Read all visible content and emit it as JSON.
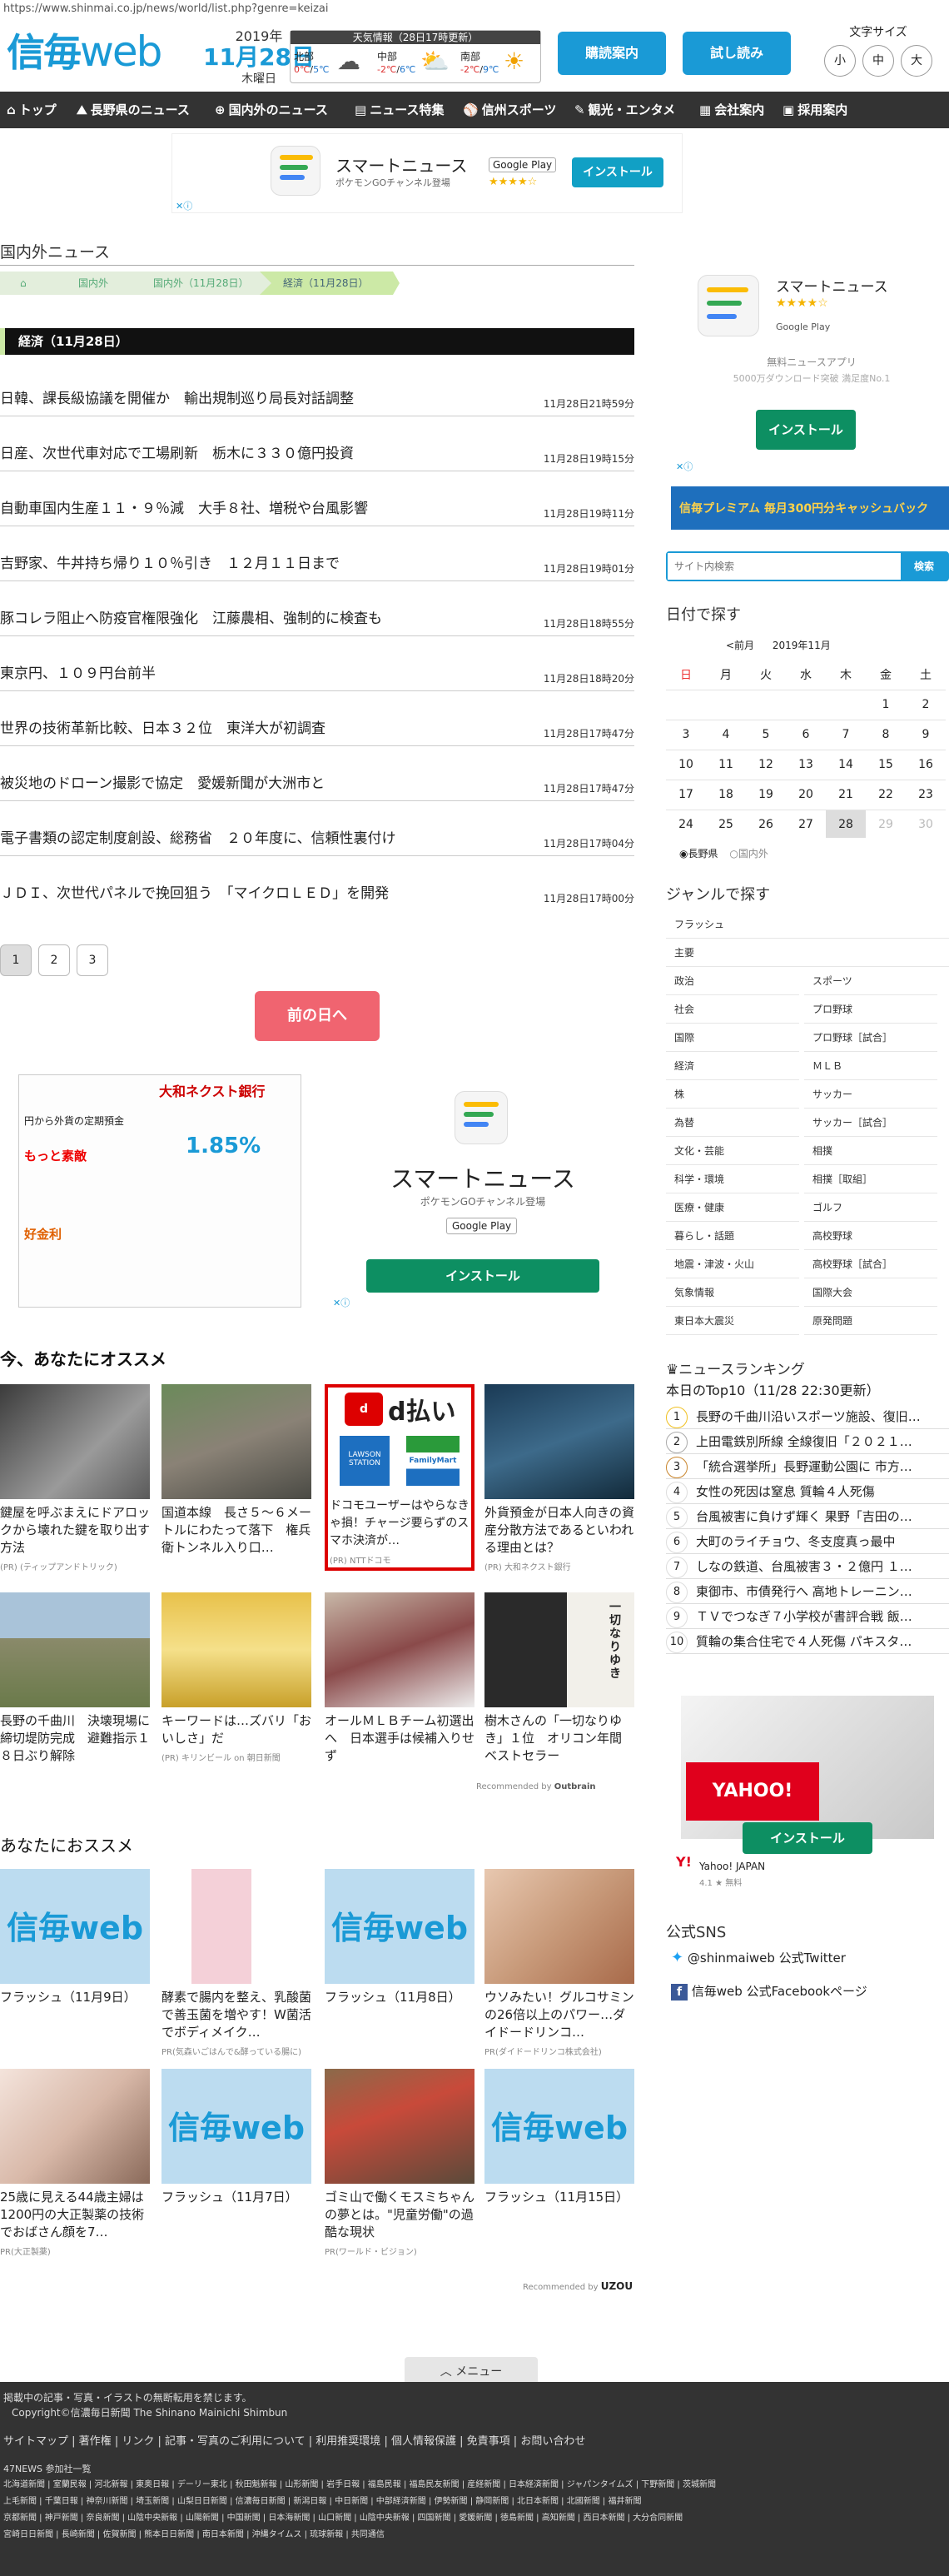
{
  "url": "https://www.shinmai.co.jp/news/world/list.php?genre=keizai",
  "header": {
    "logo_kanji": "信毎",
    "logo_web": "web",
    "date_year": "2019年",
    "date_md": "11月28日",
    "date_wday": "木曜日",
    "weather_title": "天気情報（28日17時更新）",
    "weather": [
      {
        "name": "北部",
        "hi": "0℃",
        "lo": "5℃",
        "icon": "cloud-icon",
        "glyph": "☁"
      },
      {
        "name": "中部",
        "hi": "-2℃",
        "lo": "6℃",
        "icon": "cloud-sun-icon",
        "glyph": "⛅"
      },
      {
        "name": "南部",
        "hi": "-2℃",
        "lo": "9℃",
        "icon": "sun-icon",
        "glyph": "☀"
      }
    ],
    "subscribe": "購読案内",
    "trial": "試し読み",
    "fontsize_label": "文字サイズ",
    "fontsizes": [
      "小",
      "中",
      "大"
    ]
  },
  "nav": [
    {
      "label": "トップ",
      "glyph": "⌂"
    },
    {
      "label": "長野県のニュース",
      "glyph": "⛰"
    },
    {
      "label": "国内外のニュース",
      "glyph": "⊕"
    },
    {
      "label": "ニュース特集",
      "glyph": "▤"
    },
    {
      "label": "信州スポーツ",
      "glyph": "⚾"
    },
    {
      "label": "観光・エンタメ",
      "glyph": "✎"
    },
    {
      "label": "会社案内",
      "glyph": "▦"
    },
    {
      "label": "採用案内",
      "glyph": "▣"
    }
  ],
  "ad": {
    "app_name": "スマートニュース",
    "app_sub": "ポケモンGOチャンネル登場",
    "gplay": "Google Play",
    "install": "インストール",
    "stars": "★★★★☆",
    "side_desc": "無料ニュースアプリ",
    "side_desc2": "5000万ダウンロード突破 満足度No.1"
  },
  "page_title": "国内外ニュース",
  "breadcrumbs": [
    "国内外",
    "国内外（11月28日）",
    "経済（11月28日）"
  ],
  "section_title": "経済（11月28日）",
  "news": [
    {
      "title": "日韓、課長級協議を開催か　輸出規制巡り局長対話調整",
      "date": "11月28日21時59分"
    },
    {
      "title": "日産、次世代車対応で工場刷新　栃木に３３０億円投資",
      "date": "11月28日19時15分"
    },
    {
      "title": "自動車国内生産１１・９％減　大手８社、増税や台風影響",
      "date": "11月28日19時11分"
    },
    {
      "title": "吉野家、牛丼持ち帰り１０％引き　１２月１１日まで",
      "date": "11月28日19時01分"
    },
    {
      "title": "豚コレラ阻止へ防疫官権限強化　江藤農相、強制的に検査も",
      "date": "11月28日18時55分"
    },
    {
      "title": "東京円、１０９円台前半",
      "date": "11月28日18時20分"
    },
    {
      "title": "世界の技術革新比較、日本３２位　東洋大が初調査",
      "date": "11月28日17時47分"
    },
    {
      "title": "被災地のドローン撮影で協定　愛媛新聞が大洲市と",
      "date": "11月28日17時47分"
    },
    {
      "title": "電子書類の認定制度創設、総務省　２０年度に、信頼性裏付け",
      "date": "11月28日17時04分"
    },
    {
      "title": "ＪＤＩ、次世代パネルで挽回狙う　「マイクロＬＥＤ」を開発",
      "date": "11月28日17時00分"
    }
  ],
  "pages": [
    "1",
    "2",
    "3"
  ],
  "prev_day": "前の日へ",
  "bank_ad": {
    "brand": "大和ネクスト銀行",
    "rate": "1.85",
    "l1": "円から外貨の定期預金",
    "l2": "金利",
    "l3": "もっと素敵",
    "l4": "好金利"
  },
  "osusume_title": "今、あなたにオススメ",
  "osusume": [
    {
      "title": "鍵屋を呼ぶまえにドアロックから壊れた鍵を取り出す方法",
      "src": "(PR) (ティップアンドトリック)"
    },
    {
      "title": "国道本線　長さ５～６メートルにわたって落下　権兵衛トンネル入り口…",
      "src": ""
    },
    {
      "title": "ドコモユーザーはやらなきゃ損！チャージ要らずのスマホ決済が…",
      "src": "(PR) NTTドコモ"
    },
    {
      "title": "外貨預金が日本人向きの資産分散方法であるといわれる理由とは？",
      "src": "(PR) 大和ネクスト銀行"
    },
    {
      "title": "長野の千曲川　決壊現場に締切堤防完成　避難指示１８日ぶり解除",
      "src": ""
    },
    {
      "title": "キーワードは…ズバリ「おいしさ」だ",
      "src": "(PR) キリンビール on 朝日新聞"
    },
    {
      "title": "オールＭＬＢチーム初選出へ　日本選手は候補入りせず",
      "src": ""
    },
    {
      "title": "樹木さんの「一切なりゆき」１位　オリコン年間ベストセラー",
      "src": ""
    }
  ],
  "dbarai": {
    "title": "d払い",
    "lawson": "LAWSON",
    "station": "STATION",
    "fm": "FamilyMart"
  },
  "book": "一切なりゆき",
  "recommended_by": "Recommended by",
  "outbrain": "Outbrain",
  "anata_title": "あなたにおススメ",
  "anata": [
    {
      "title": "フラッシュ（11月9日）",
      "src": "",
      "logo": true
    },
    {
      "title": "酵素で腸内を整え、乳酸菌で善玉菌を増やす！W菌活でボディメイク…",
      "src": "PR(気森いごはんで&酵っている腸に)",
      "logo": false
    },
    {
      "title": "フラッシュ（11月8日）",
      "src": "",
      "logo": true
    },
    {
      "title": "ウソみたい！グルコサミンの26倍以上のパワー…ダイドードリンコ…",
      "src": "PR(ダイドードリンコ株式会社)",
      "logo": false
    },
    {
      "title": "25歳に見える44歳主婦は1200円の大正製薬の技術でおばさん顔を7…",
      "src": "PR(大正製薬)",
      "logo": false
    },
    {
      "title": "フラッシュ（11月7日）",
      "src": "",
      "logo": true
    },
    {
      "title": "ゴミ山で働くモスミちゃんの夢とは。\"児童労働\"の過酷な現状",
      "src": "PR(ワールド・ビジョン)",
      "logo": false
    },
    {
      "title": "フラッシュ（11月15日）",
      "src": "",
      "logo": true
    }
  ],
  "shinmai_logo_small": "信毎web",
  "recommended_by2": "Recommended by",
  "uzou": "UZOU",
  "sidebar": {
    "prem_text": "信毎プレミアム 毎月300円分キャッシュバック",
    "search_placeholder": "サイト内検索",
    "search_btn": "検索",
    "by_date": "日付で探す",
    "prev_month": "<前月",
    "month": "2019年11月",
    "weekdays": [
      "日",
      "月",
      "火",
      "水",
      "木",
      "金",
      "土"
    ],
    "days": [
      [
        "",
        "",
        "",
        "",
        "",
        "1",
        "2"
      ],
      [
        "3",
        "4",
        "5",
        "6",
        "7",
        "8",
        "9"
      ],
      [
        "10",
        "11",
        "12",
        "13",
        "14",
        "15",
        "16"
      ],
      [
        "17",
        "18",
        "19",
        "20",
        "21",
        "22",
        "23"
      ],
      [
        "24",
        "25",
        "26",
        "27",
        "28",
        "29",
        "30"
      ]
    ],
    "radio1": "長野県",
    "radio2": "国内外",
    "by_genre": "ジャンルで探す",
    "genres": [
      "フラッシュ",
      "主要",
      "政治",
      "スポーツ",
      "社会",
      "プロ野球",
      "国際",
      "プロ野球［試合］",
      "経済",
      "ＭＬＢ",
      "株",
      "サッカー",
      "為替",
      "サッカー［試合］",
      "文化・芸能",
      "相撲",
      "科学・環境",
      "相撲［取組］",
      "医療・健康",
      "ゴルフ",
      "暮らし・話題",
      "高校野球",
      "地震・津波・火山",
      "高校野球［試合］",
      "気象情報",
      "国際大会",
      "東日本大震災",
      "原発問題"
    ],
    "ranking_title": "ニュースランキング",
    "ranking_sub": "本日のTop10（11/28 22:30更新）",
    "ranking": [
      "長野の千曲川沿いスポーツ施設、復旧…",
      "上田電鉄別所線 全線復旧「２０２１…",
      "「統合選挙所」長野運動公園に 市方…",
      "女性の死因は窒息 質輪４人死傷",
      "台風被害に負けず輝く 果野「吉田の…",
      "大町のライチョウ、冬支度真っ最中",
      "しなの鉄道、台風被害３・２億円 １…",
      "東御市、市債発行へ 高地トレーニン…",
      "ＴＶでつなぎ７小学校が書評合戦 飯…",
      "質輪の集合住宅で４人死傷 パキスタ…"
    ],
    "yahoo_name": "Yahoo! JAPAN",
    "yahoo_meta": "4.1 ★ 無料",
    "sns_title": "公式SNS",
    "twitter": "@shinmaiweb 公式Twitter",
    "facebook": "信毎web 公式Facebookページ"
  },
  "footer": {
    "menu": "メニュー",
    "notice": "掲載中の記事・写真・イラストの無断転用を禁じます。",
    "copyright": "Copyright©信濃毎日新聞 The Shinano Mainichi Shimbun",
    "links": [
      "サイトマップ",
      "著作権",
      "リンク",
      "記事・写真のご利用について",
      "利用推奨環境",
      "個人情報保護",
      "免責事項",
      "お問い合わせ"
    ],
    "n47_title": "47NEWS 参加社一覧",
    "n47a": "北海道新聞 | 室蘭民報 | 河北新報 | 東奥日報 | デーリー東北 | 秋田魁新報 | 山形新聞 | 岩手日報 | 福島民報 | 福島民友新聞 | 産経新聞 | 日本経済新聞 | ジャパンタイムズ | 下野新聞 | 茨城新聞",
    "n47b": "上毛新聞 | 千葉日報 | 神奈川新聞 | 埼玉新聞 | 山梨日日新聞 | 信濃毎日新聞 | 新潟日報 | 中日新聞 | 中部経済新聞 | 伊勢新聞 | 静岡新聞 | 北日本新聞 | 北國新聞 | 福井新聞",
    "n47c": "京都新聞 | 神戸新聞 | 奈良新聞 | 山陰中央新報 | 山陽新聞 | 中国新聞 | 日本海新聞 | 山口新聞 | 山陰中央新報 | 四国新聞 | 愛媛新聞 | 徳島新聞 | 高知新聞 | 西日本新聞 | 大分合同新聞",
    "n47d": "宮崎日日新聞 | 長崎新聞 | 佐賀新聞 | 熊本日日新聞 | 南日本新聞 | 沖縄タイムス | 琉球新報 | 共同通信"
  }
}
